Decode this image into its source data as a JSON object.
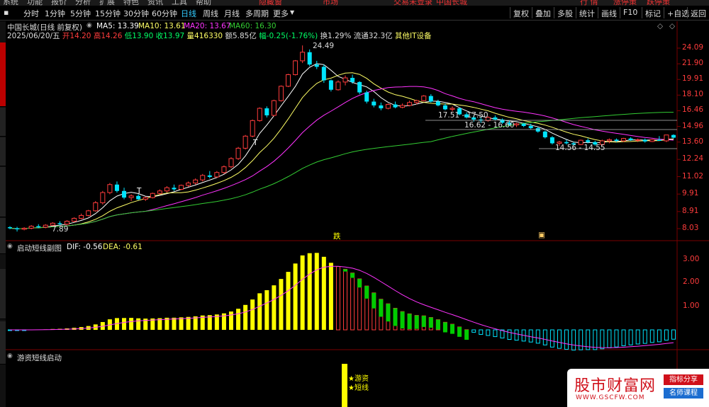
{
  "topbar": {
    "left": [
      "系统",
      "功能",
      "报价",
      "分析",
      "扩展",
      "特色",
      "资讯",
      "工具",
      "帮助"
    ],
    "center": [
      "隐藏窗",
      "市场",
      "交易未登录",
      "中国长城"
    ],
    "right": [
      "行  情",
      "涨停策",
      "跌停策"
    ]
  },
  "toolbar": {
    "periods": [
      "分时",
      "1分钟",
      "5分钟",
      "15分钟",
      "30分钟",
      "60分钟",
      "日线",
      "周线",
      "月线",
      "多周期",
      "更多"
    ],
    "active_period": "日线",
    "right_buttons": [
      "复权",
      "叠加",
      "多股",
      "统计",
      "画线",
      "F10",
      "标记",
      "+自选",
      "返回"
    ]
  },
  "stock": {
    "name": "中国长城(日线 前复权)",
    "date": "2025/06/20/五"
  },
  "ma": {
    "ma5": "MA5: 13.39",
    "ma10": "MA10: 13.61",
    "ma20": "MA20: 13.67",
    "ma60": "MA60: 16.30"
  },
  "quote": {
    "open_label": "开",
    "open": "14.20",
    "high_label": "高",
    "high": "14.26",
    "low_label": "低",
    "low": "13.90",
    "close_label": "收",
    "close": "13.97",
    "vol_label": "量",
    "vol": "416330",
    "amount": "额5.85亿",
    "change": "幅-0.25(-1.76%)",
    "turnover": "换1.29%",
    "float": "流通32.3亿",
    "sector": "其他IT设备"
  },
  "price_axis": [
    "24.09",
    "21.90",
    "19.91",
    "18.10",
    "16.46",
    "14.96",
    "13.60",
    "12.24",
    "11.02",
    "9.91",
    "8.91",
    "8.03"
  ],
  "annotations": {
    "high": "24.49",
    "low": "7.89",
    "range1": "17.51 - 17.50",
    "range2": "16.62 - 16.60",
    "range3": "14.56 - 14.55",
    "die": "跌",
    "t1": "T",
    "t2": "T"
  },
  "macd": {
    "title": "启动短线副图",
    "dif": "DIF: -0.56",
    "dea": "DEA: -0.61",
    "axis": [
      "3.00",
      "2.00",
      "1.00"
    ]
  },
  "panel3": {
    "title": "游资短线启动",
    "sig1": "★游资",
    "sig2": "★短线"
  },
  "logo": {
    "name": "股市财富网",
    "url": "WWW.GSCFW.COM",
    "badge1": "指标分享",
    "badge2": "名师课程"
  },
  "colors": {
    "up": "#ff3c3c",
    "down": "#00e5ff",
    "ma5": "#ffffff",
    "ma10": "#ffff66",
    "ma20": "#ff33ff",
    "ma60": "#33cc33",
    "yellow": "#ffff00",
    "green": "#00cc00"
  },
  "chart_data": {
    "type": "candlestick",
    "candles": [
      [
        8.1,
        8.15,
        8.0,
        8.05
      ],
      [
        8.05,
        8.12,
        7.89,
        8.0
      ],
      [
        8.0,
        8.1,
        7.95,
        8.05
      ],
      [
        8.05,
        8.2,
        8.0,
        8.15
      ],
      [
        8.15,
        8.25,
        8.05,
        8.1
      ],
      [
        8.1,
        8.25,
        8.05,
        8.2
      ],
      [
        8.2,
        8.35,
        8.15,
        8.3
      ],
      [
        8.3,
        8.4,
        8.2,
        8.25
      ],
      [
        8.25,
        8.45,
        8.2,
        8.4
      ],
      [
        8.4,
        8.6,
        8.35,
        8.55
      ],
      [
        8.55,
        8.8,
        8.5,
        8.7
      ],
      [
        8.7,
        9.0,
        8.65,
        8.95
      ],
      [
        8.95,
        9.5,
        8.9,
        9.4
      ],
      [
        9.4,
        10.1,
        9.3,
        10.0
      ],
      [
        10.0,
        10.6,
        9.9,
        10.5
      ],
      [
        10.5,
        10.7,
        10.0,
        10.1
      ],
      [
        10.1,
        10.3,
        9.6,
        9.7
      ],
      [
        9.7,
        9.9,
        9.5,
        9.8
      ],
      [
        9.8,
        9.9,
        9.55,
        9.6
      ],
      [
        9.6,
        9.75,
        9.5,
        9.7
      ],
      [
        9.7,
        10.0,
        9.65,
        9.95
      ],
      [
        9.95,
        10.2,
        9.9,
        10.1
      ],
      [
        10.1,
        10.4,
        10.0,
        10.3
      ],
      [
        10.3,
        10.5,
        10.1,
        10.2
      ],
      [
        10.2,
        10.5,
        10.15,
        10.45
      ],
      [
        10.45,
        10.7,
        10.35,
        10.6
      ],
      [
        10.6,
        10.9,
        10.5,
        10.8
      ],
      [
        10.8,
        11.2,
        10.7,
        11.1
      ],
      [
        11.1,
        11.4,
        10.9,
        11.0
      ],
      [
        11.0,
        11.4,
        10.95,
        11.3
      ],
      [
        11.3,
        11.8,
        11.2,
        11.7
      ],
      [
        11.7,
        12.4,
        11.6,
        12.3
      ],
      [
        12.3,
        13.2,
        12.2,
        13.1
      ],
      [
        13.1,
        14.2,
        13.0,
        14.1
      ],
      [
        14.1,
        15.6,
        14.0,
        15.5
      ],
      [
        15.5,
        16.8,
        15.4,
        16.7
      ],
      [
        16.7,
        16.9,
        15.8,
        16.0
      ],
      [
        16.0,
        17.6,
        15.9,
        17.5
      ],
      [
        17.5,
        19.2,
        17.4,
        19.1
      ],
      [
        19.1,
        20.6,
        19.0,
        20.5
      ],
      [
        20.5,
        22.4,
        20.4,
        22.3
      ],
      [
        22.3,
        24.49,
        22.0,
        23.5
      ],
      [
        23.5,
        23.9,
        21.6,
        21.8
      ],
      [
        21.8,
        22.3,
        21.2,
        21.5
      ],
      [
        21.5,
        21.8,
        19.5,
        19.8
      ],
      [
        19.8,
        19.9,
        18.5,
        18.7
      ],
      [
        18.7,
        19.8,
        18.6,
        19.6
      ],
      [
        19.6,
        20.4,
        19.2,
        20.1
      ],
      [
        20.1,
        20.5,
        19.4,
        19.6
      ],
      [
        19.6,
        19.7,
        18.2,
        18.4
      ],
      [
        18.4,
        18.6,
        17.2,
        17.4
      ],
      [
        17.4,
        17.7,
        16.8,
        17.0
      ],
      [
        17.0,
        17.3,
        16.5,
        16.7
      ],
      [
        16.7,
        17.2,
        16.6,
        17.1
      ],
      [
        17.1,
        17.4,
        16.7,
        16.8
      ],
      [
        16.8,
        17.2,
        16.7,
        17.0
      ],
      [
        17.0,
        17.5,
        16.9,
        17.3
      ],
      [
        17.3,
        17.6,
        17.1,
        17.5
      ],
      [
        17.5,
        18.1,
        17.4,
        18.0
      ],
      [
        18.0,
        18.2,
        17.3,
        17.4
      ],
      [
        17.4,
        17.6,
        16.9,
        17.0
      ],
      [
        17.0,
        17.2,
        16.5,
        16.6
      ],
      [
        16.6,
        16.9,
        16.4,
        16.7
      ],
      [
        16.7,
        16.8,
        16.0,
        16.1
      ],
      [
        16.1,
        16.3,
        15.7,
        15.8
      ],
      [
        15.8,
        16.0,
        15.4,
        15.6
      ],
      [
        15.6,
        15.8,
        15.3,
        15.5
      ],
      [
        15.5,
        15.9,
        15.4,
        15.8
      ],
      [
        15.8,
        16.0,
        15.5,
        15.6
      ],
      [
        15.6,
        15.7,
        15.2,
        15.3
      ],
      [
        15.3,
        15.5,
        15.0,
        15.1
      ],
      [
        15.1,
        15.3,
        14.9,
        15.2
      ],
      [
        15.2,
        15.3,
        14.9,
        15.0
      ],
      [
        15.0,
        15.2,
        14.7,
        14.8
      ],
      [
        14.8,
        14.9,
        14.4,
        14.5
      ],
      [
        14.5,
        14.6,
        13.9,
        14.0
      ],
      [
        14.0,
        14.1,
        13.4,
        13.5
      ],
      [
        13.5,
        13.7,
        13.3,
        13.6
      ],
      [
        13.6,
        13.8,
        13.4,
        13.5
      ],
      [
        13.5,
        13.6,
        13.3,
        13.4
      ],
      [
        13.4,
        13.8,
        13.35,
        13.75
      ],
      [
        13.75,
        13.9,
        13.5,
        13.6
      ],
      [
        13.6,
        13.7,
        13.3,
        13.4
      ],
      [
        13.4,
        13.8,
        13.3,
        13.7
      ],
      [
        13.7,
        13.9,
        13.5,
        13.8
      ],
      [
        13.8,
        13.9,
        13.6,
        13.7
      ],
      [
        13.7,
        13.95,
        13.6,
        13.9
      ],
      [
        13.9,
        14.0,
        13.7,
        13.75
      ],
      [
        13.75,
        13.9,
        13.6,
        13.8
      ],
      [
        13.8,
        13.9,
        13.55,
        13.65
      ],
      [
        13.65,
        13.85,
        13.6,
        13.8
      ],
      [
        13.8,
        14.1,
        13.7,
        13.7
      ],
      [
        13.7,
        14.2,
        13.6,
        14.2
      ],
      [
        14.2,
        14.26,
        13.9,
        13.97
      ]
    ]
  }
}
